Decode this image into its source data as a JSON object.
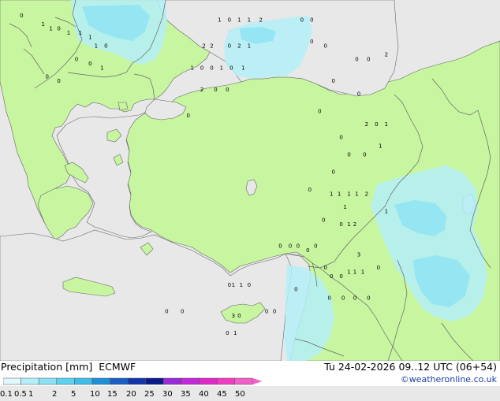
{
  "footer": {
    "title": "Precipitation [mm]",
    "model": "ECMWF",
    "date": "Tu 24-02-2026 09..12 UTC (06+54)",
    "credit": "©weatheronline.co.uk"
  },
  "legend": {
    "labels": [
      "0.1",
      "0.5",
      "1",
      "2",
      "5",
      "10",
      "15",
      "20",
      "25",
      "30",
      "35",
      "40",
      "45",
      "50"
    ],
    "colors": [
      "#e0f7fc",
      "#b4eef8",
      "#8ce2f4",
      "#5cd2ee",
      "#3fbce8",
      "#1e90d8",
      "#1a5fc4",
      "#1236a8",
      "#0a1a88",
      "#9a2ad8",
      "#c428d8",
      "#e028c8",
      "#f03cc0",
      "#f060c8"
    ]
  },
  "map_colors": {
    "sea": "#e8e8e8",
    "land": "#c8f5a0",
    "border": "#666666",
    "precip_light": "#b4eef8",
    "precip_medium": "#8ce2f4"
  },
  "map_values": [
    {
      "v": "0",
      "lon": 20.1,
      "lat": 41.9
    },
    {
      "v": "1",
      "lon": 21.2,
      "lat": 41.7
    },
    {
      "v": "1",
      "lon": 21.6,
      "lat": 41.6
    },
    {
      "v": "0",
      "lon": 22.0,
      "lat": 41.6
    },
    {
      "v": "1",
      "lon": 22.5,
      "lat": 41.5
    },
    {
      "v": "1",
      "lon": 23.1,
      "lat": 41.5
    },
    {
      "v": "1",
      "lon": 23.6,
      "lat": 41.4
    },
    {
      "v": "1",
      "lon": 23.9,
      "lat": 41.2
    },
    {
      "v": "0",
      "lon": 24.4,
      "lat": 41.2
    },
    {
      "v": "0",
      "lon": 22.9,
      "lat": 40.9
    },
    {
      "v": "0",
      "lon": 23.6,
      "lat": 40.8
    },
    {
      "v": "1",
      "lon": 24.2,
      "lat": 40.7
    },
    {
      "v": "0",
      "lon": 21.4,
      "lat": 40.5
    },
    {
      "v": "0",
      "lon": 22.0,
      "lat": 40.4
    },
    {
      "v": "1",
      "lon": 30.2,
      "lat": 41.8
    },
    {
      "v": "0",
      "lon": 30.7,
      "lat": 41.8
    },
    {
      "v": "1",
      "lon": 31.2,
      "lat": 41.8
    },
    {
      "v": "1",
      "lon": 31.7,
      "lat": 41.8
    },
    {
      "v": "2",
      "lon": 32.3,
      "lat": 41.8
    },
    {
      "v": "2",
      "lon": 29.4,
      "lat": 41.2
    },
    {
      "v": "2",
      "lon": 29.8,
      "lat": 41.2
    },
    {
      "v": "0",
      "lon": 30.7,
      "lat": 41.2
    },
    {
      "v": "2",
      "lon": 31.2,
      "lat": 41.2
    },
    {
      "v": "1",
      "lon": 31.7,
      "lat": 41.2
    },
    {
      "v": "1",
      "lon": 28.8,
      "lat": 40.7
    },
    {
      "v": "0",
      "lon": 29.3,
      "lat": 40.7
    },
    {
      "v": "0",
      "lon": 29.8,
      "lat": 40.7
    },
    {
      "v": "1",
      "lon": 30.3,
      "lat": 40.7
    },
    {
      "v": "0",
      "lon": 30.8,
      "lat": 40.7
    },
    {
      "v": "1",
      "lon": 31.4,
      "lat": 40.7
    },
    {
      "v": "2",
      "lon": 29.3,
      "lat": 40.2
    },
    {
      "v": "0",
      "lon": 30.0,
      "lat": 40.2
    },
    {
      "v": "0",
      "lon": 30.6,
      "lat": 40.2
    },
    {
      "v": "0",
      "lon": 28.6,
      "lat": 39.6
    },
    {
      "v": "0",
      "lon": 34.4,
      "lat": 41.8
    },
    {
      "v": "0",
      "lon": 34.9,
      "lat": 41.8
    },
    {
      "v": "0",
      "lon": 34.9,
      "lat": 41.3
    },
    {
      "v": "0",
      "lon": 35.6,
      "lat": 41.2
    },
    {
      "v": "0",
      "lon": 37.2,
      "lat": 40.9
    },
    {
      "v": "0",
      "lon": 37.8,
      "lat": 40.9
    },
    {
      "v": "2",
      "lon": 38.7,
      "lat": 41.0
    },
    {
      "v": "0",
      "lon": 36.0,
      "lat": 40.4
    },
    {
      "v": "0",
      "lon": 37.3,
      "lat": 40.1
    },
    {
      "v": "0",
      "lon": 35.3,
      "lat": 39.7
    },
    {
      "v": "2",
      "lon": 37.7,
      "lat": 39.4
    },
    {
      "v": "0",
      "lon": 38.2,
      "lat": 39.4
    },
    {
      "v": "1",
      "lon": 38.7,
      "lat": 39.4
    },
    {
      "v": "0",
      "lon": 36.4,
      "lat": 39.1
    },
    {
      "v": "1",
      "lon": 38.4,
      "lat": 38.9
    },
    {
      "v": "0",
      "lon": 36.8,
      "lat": 38.7
    },
    {
      "v": "0",
      "lon": 37.6,
      "lat": 38.7
    },
    {
      "v": "0",
      "lon": 36.0,
      "lat": 38.3
    },
    {
      "v": "0",
      "lon": 34.8,
      "lat": 37.9
    },
    {
      "v": "1",
      "lon": 35.9,
      "lat": 37.8
    },
    {
      "v": "1",
      "lon": 36.3,
      "lat": 37.8
    },
    {
      "v": "1",
      "lon": 36.8,
      "lat": 37.8
    },
    {
      "v": "1",
      "lon": 37.2,
      "lat": 37.8
    },
    {
      "v": "2",
      "lon": 37.7,
      "lat": 37.8
    },
    {
      "v": "1",
      "lon": 36.6,
      "lat": 37.5
    },
    {
      "v": "1",
      "lon": 38.7,
      "lat": 37.4
    },
    {
      "v": "0",
      "lon": 35.5,
      "lat": 37.2
    },
    {
      "v": "0",
      "lon": 36.4,
      "lat": 37.1
    },
    {
      "v": "1",
      "lon": 36.8,
      "lat": 37.1
    },
    {
      "v": "2",
      "lon": 37.1,
      "lat": 37.1
    },
    {
      "v": "0",
      "lon": 33.3,
      "lat": 36.6
    },
    {
      "v": "0",
      "lon": 33.8,
      "lat": 36.6
    },
    {
      "v": "0",
      "lon": 34.2,
      "lat": 36.6
    },
    {
      "v": "0",
      "lon": 34.7,
      "lat": 36.5
    },
    {
      "v": "0",
      "lon": 35.1,
      "lat": 36.6
    },
    {
      "v": "3",
      "lon": 37.3,
      "lat": 36.4
    },
    {
      "v": "0",
      "lon": 35.6,
      "lat": 36.1
    },
    {
      "v": "1",
      "lon": 36.8,
      "lat": 36.0
    },
    {
      "v": "1",
      "lon": 37.1,
      "lat": 36.0
    },
    {
      "v": "1",
      "lon": 37.5,
      "lat": 36.0
    },
    {
      "v": "0",
      "lon": 38.3,
      "lat": 36.1
    },
    {
      "v": "0",
      "lon": 34.1,
      "lat": 35.6
    },
    {
      "v": "0",
      "lon": 35.9,
      "lat": 35.9
    },
    {
      "v": "0",
      "lon": 36.4,
      "lat": 35.9
    },
    {
      "v": "0",
      "lon": 35.8,
      "lat": 35.4
    },
    {
      "v": "0",
      "lon": 36.5,
      "lat": 35.4
    },
    {
      "v": "0",
      "lon": 37.1,
      "lat": 35.4
    },
    {
      "v": "0",
      "lon": 37.8,
      "lat": 35.4
    },
    {
      "v": "0",
      "lon": 30.7,
      "lat": 35.7
    },
    {
      "v": "1",
      "lon": 30.9,
      "lat": 35.7
    },
    {
      "v": "1",
      "lon": 31.3,
      "lat": 35.7
    },
    {
      "v": "0",
      "lon": 31.7,
      "lat": 35.7
    },
    {
      "v": "3",
      "lon": 30.9,
      "lat": 35.0
    },
    {
      "v": "0",
      "lon": 31.2,
      "lat": 35.0
    },
    {
      "v": "0",
      "lon": 32.6,
      "lat": 35.1
    },
    {
      "v": "0",
      "lon": 33.0,
      "lat": 35.1
    },
    {
      "v": "0",
      "lon": 27.5,
      "lat": 35.1
    },
    {
      "v": "0",
      "lon": 28.3,
      "lat": 35.1
    },
    {
      "v": "0",
      "lon": 30.6,
      "lat": 34.6
    },
    {
      "v": "1",
      "lon": 31.0,
      "lat": 34.6
    }
  ]
}
